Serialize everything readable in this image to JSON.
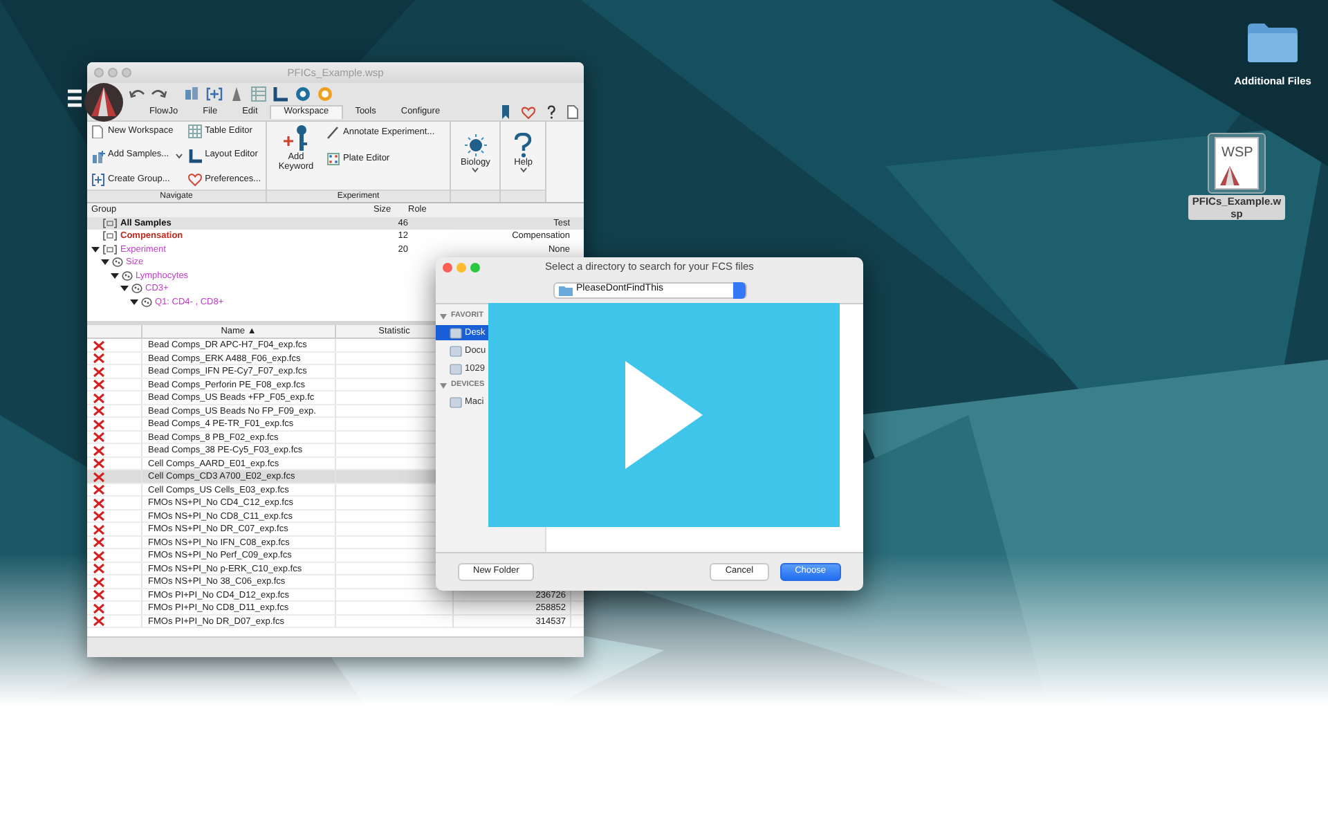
{
  "desktop_icons": [
    {
      "kind": "folder",
      "label": "Additional Files",
      "selected": false
    },
    {
      "kind": "document",
      "badge": "WSP",
      "label": "PFICs_Example.wsp",
      "selected": true
    }
  ],
  "flowjo_window": {
    "title": "PFICs_Example.wsp",
    "menu_tabs": [
      {
        "label": "FlowJo",
        "selected": false
      },
      {
        "label": "File",
        "selected": false
      },
      {
        "label": "Edit",
        "selected": false
      },
      {
        "label": "Workspace",
        "selected": true
      },
      {
        "label": "Tools",
        "selected": false
      },
      {
        "label": "Configure",
        "selected": false
      }
    ],
    "ribbon_groups": [
      {
        "label": "Navigate",
        "items": [
          {
            "label": "New Workspace",
            "dropdown": false
          },
          {
            "label": "Add Samples...",
            "dropdown": true
          },
          {
            "label": "Create Group...",
            "dropdown": false
          },
          {
            "label": "Table Editor",
            "dropdown": false
          },
          {
            "label": "Layout Editor",
            "dropdown": false
          },
          {
            "label": "Preferences...",
            "dropdown": false
          }
        ]
      },
      {
        "label": "Experiment",
        "items": [
          {
            "label": "Add Keyword",
            "dropdown": false
          },
          {
            "label": "Annotate Experiment...",
            "dropdown": false
          },
          {
            "label": "Plate Editor",
            "dropdown": false
          }
        ]
      },
      {
        "items": [
          {
            "label": "Biology",
            "dropdown": true
          }
        ]
      },
      {
        "items": [
          {
            "label": "Help",
            "dropdown": true
          }
        ]
      }
    ],
    "group_table": {
      "columns": [
        "Group",
        "Size",
        "Role"
      ],
      "rows": [
        {
          "kind": "group",
          "label": "All Samples",
          "size": "46",
          "role": "Test",
          "color": "#111111",
          "selected": true
        },
        {
          "kind": "group",
          "label": "Compensation",
          "size": "12",
          "role": "Compensation",
          "color": "#c0281e",
          "selected": false
        },
        {
          "kind": "group",
          "label": "Experiment",
          "size": "20",
          "role": "None",
          "color": "#c03cc8",
          "selected": false,
          "expanded": true,
          "children": [
            {
              "kind": "gate",
              "label": "Size",
              "color": "#c03cc8",
              "selected": false,
              "expanded": true,
              "children": [
                {
                  "kind": "gate",
                  "label": "Lymphocytes",
                  "color": "#c03cc8",
                  "selected": false,
                  "expanded": true,
                  "children": [
                    {
                      "kind": "gate",
                      "label": "CD3+",
                      "color": "#c03cc8",
                      "selected": false,
                      "expanded": true,
                      "children": [
                        {
                          "kind": "gate",
                          "label": "Q1: CD4- , CD8+",
                          "color": "#c03cc8",
                          "selected": false,
                          "expanded": true
                        }
                      ]
                    }
                  ]
                }
              ]
            }
          ]
        }
      ]
    },
    "sample_table": {
      "columns": [
        {
          "label": "Name",
          "sort_indicator": "▲"
        },
        {
          "label": "Statistic"
        }
      ],
      "rows": [
        {
          "name": "Bead Comps_DR APC-H7_F04_exp.fcs",
          "missing": true,
          "selected": false
        },
        {
          "name": "Bead Comps_ERK A488_F06_exp.fcs",
          "missing": true,
          "selected": false
        },
        {
          "name": "Bead Comps_IFN PE-Cy7_F07_exp.fcs",
          "missing": true,
          "selected": false
        },
        {
          "name": "Bead Comps_Perforin PE_F08_exp.fcs",
          "missing": true,
          "selected": false
        },
        {
          "name": "Bead Comps_US Beads +FP_F05_exp.fc",
          "missing": true,
          "selected": false
        },
        {
          "name": "Bead Comps_US Beads No FP_F09_exp.",
          "missing": true,
          "selected": false
        },
        {
          "name": "Bead Comps_4 PE-TR_F01_exp.fcs",
          "missing": true,
          "selected": false
        },
        {
          "name": "Bead Comps_8 PB_F02_exp.fcs",
          "missing": true,
          "selected": false
        },
        {
          "name": "Bead Comps_38 PE-Cy5_F03_exp.fcs",
          "missing": true,
          "selected": false
        },
        {
          "name": "Cell Comps_AARD_E01_exp.fcs",
          "missing": true,
          "selected": false
        },
        {
          "name": "Cell Comps_CD3 A700_E02_exp.fcs",
          "missing": true,
          "selected": true
        },
        {
          "name": "Cell Comps_US Cells_E03_exp.fcs",
          "missing": true,
          "selected": false
        },
        {
          "name": "FMOs NS+PI_No CD4_C12_exp.fcs",
          "missing": true,
          "selected": false
        },
        {
          "name": "FMOs NS+PI_No CD8_C11_exp.fcs",
          "missing": true,
          "selected": false
        },
        {
          "name": "FMOs NS+PI_No DR_C07_exp.fcs",
          "missing": true,
          "selected": false
        },
        {
          "name": "FMOs NS+PI_No IFN_C08_exp.fcs",
          "missing": true,
          "selected": false
        },
        {
          "name": "FMOs NS+PI_No Perf_C09_exp.fcs",
          "missing": true,
          "selected": false
        },
        {
          "name": "FMOs NS+PI_No p-ERK_C10_exp.fcs",
          "missing": true,
          "selected": false
        },
        {
          "name": "FMOs NS+PI_No 38_C06_exp.fcs",
          "missing": true,
          "selected": false
        },
        {
          "name": "FMOs PI+PI_No CD4_D12_exp.fcs",
          "column_3": "236726",
          "missing": true,
          "selected": false
        },
        {
          "name": "FMOs PI+PI_No CD8_D11_exp.fcs",
          "column_3": "258852",
          "missing": true,
          "selected": false
        },
        {
          "name": "FMOs PI+PI_No DR_D07_exp.fcs",
          "column_3": "314537",
          "missing": true,
          "selected": false
        }
      ]
    }
  },
  "dialog": {
    "title": "Select a directory to search for your FCS files",
    "location": "PleaseDontFindThis",
    "sidebar": [
      {
        "kind": "header",
        "label": "FAVORIT",
        "expanded": true
      },
      {
        "kind": "item",
        "label": "Desk",
        "selected": true
      },
      {
        "kind": "item",
        "label": "Docu",
        "selected": false
      },
      {
        "kind": "item",
        "label": "1029",
        "selected": false
      },
      {
        "kind": "header",
        "label": "DEVICES",
        "expanded": true
      },
      {
        "kind": "item",
        "label": "Maci",
        "selected": false
      }
    ],
    "buttons": [
      {
        "label": "New Folder",
        "kind": "plain"
      },
      {
        "label": "Cancel",
        "kind": "plain"
      },
      {
        "label": "Choose",
        "kind": "default"
      }
    ]
  }
}
